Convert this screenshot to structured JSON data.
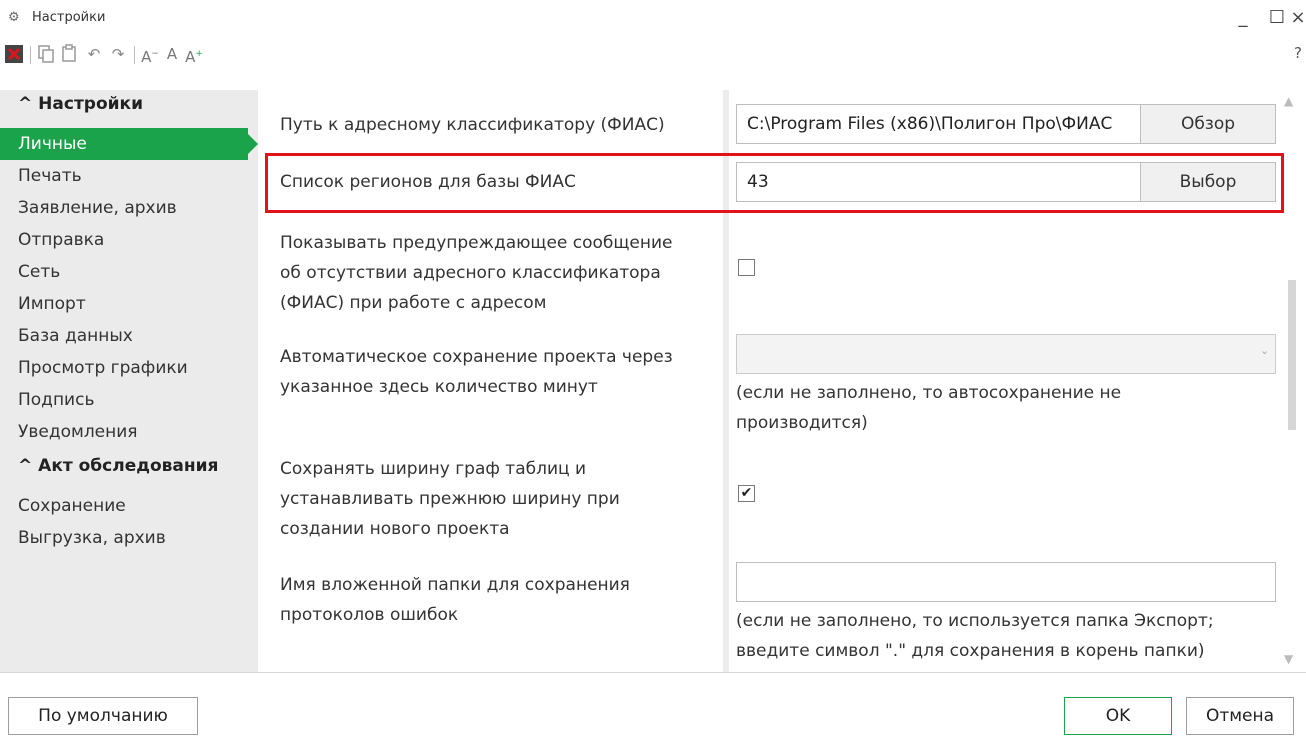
{
  "window": {
    "title": "Настройки",
    "title_icon": "gears-icon",
    "min_symbol": "_",
    "max_symbol": "☐",
    "close_symbol": "×"
  },
  "toolbar": {
    "icons": [
      "close-red-icon",
      "copy-icon",
      "paste-icon",
      "undo-icon",
      "redo-icon",
      "font-decrease-icon",
      "font-normal-icon",
      "font-increase-icon"
    ],
    "help": "?"
  },
  "sidebar": {
    "group1": "^ Настройки",
    "items1": [
      "Личные",
      "Печать",
      "Заявление, архив",
      "Отправка",
      "Сеть",
      "Импорт",
      "База данных",
      "Просмотр графики",
      "Подпись",
      "Уведомления"
    ],
    "group2": "^ Акт обследования",
    "items2": [
      "Сохранение",
      "Выгрузка, архив"
    ],
    "active_color": "#1aa34a"
  },
  "settings": {
    "fias_path_label": "Путь к адресному классификатору (ФИАС)",
    "fias_path_value": "C:\\Program Files (x86)\\Полигон Про\\ФИАС",
    "browse_label": "Обзор",
    "regions_label": "Список регионов для базы ФИАС",
    "regions_value": "43",
    "choose_label": "Выбор",
    "warn_line1": "Показывать предупреждающее сообщение",
    "warn_line2": "об отсутствии адресного классификатора",
    "warn_line3": "(ФИАС) при работе с адресом",
    "warn_checked": false,
    "autosave_line1": "Автоматическое сохранение проекта через",
    "autosave_line2": "указанное здесь количество минут",
    "autosave_value": "",
    "autosave_hint1": "(если не заполнено, то автосохранение не",
    "autosave_hint2": "производится)",
    "width_line1": "Сохранять ширину граф таблиц и",
    "width_line2": "устанавливать прежнюю ширину при",
    "width_line3": "создании нового проекта",
    "width_checked": true,
    "folder_line1": "Имя вложенной папки для сохранения",
    "folder_line2": "протоколов ошибок",
    "folder_value": "",
    "folder_hint1": "(если не заполнено, то используется папка Экспорт;",
    "folder_hint2": "введите символ \".\" для сохранения в корень папки)",
    "highlight_color": "#e0131b"
  },
  "footer": {
    "default_label": "По умолчанию",
    "ok_label": "OK",
    "cancel_label": "Отмена"
  }
}
